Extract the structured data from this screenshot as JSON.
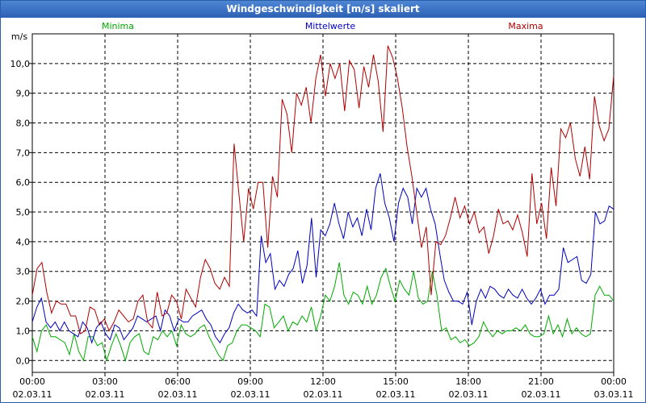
{
  "window": {
    "title": "Windgeschwindigkeit [m/s] skaliert"
  },
  "chart_data": {
    "type": "line",
    "title": "Windgeschwindigkeit [m/s] skaliert",
    "ylabel": "m/s",
    "ylim": [
      -0.4,
      11.0
    ],
    "yticks": [
      "0,0",
      "1,0",
      "2,0",
      "3,0",
      "4,0",
      "5,0",
      "6,0",
      "7,0",
      "8,0",
      "9,0",
      "10,0"
    ],
    "ytick_values": [
      0,
      1,
      2,
      3,
      4,
      5,
      6,
      7,
      8,
      9,
      10
    ],
    "xlim_hours": [
      0,
      24
    ],
    "xticks": [
      {
        "time": "00:00",
        "date": "02.03.11"
      },
      {
        "time": "03:00",
        "date": "02.03.11"
      },
      {
        "time": "06:00",
        "date": "02.03.11"
      },
      {
        "time": "09:00",
        "date": "02.03.11"
      },
      {
        "time": "12:00",
        "date": "02.03.11"
      },
      {
        "time": "15:00",
        "date": "02.03.11"
      },
      {
        "time": "18:00",
        "date": "02.03.11"
      },
      {
        "time": "21:00",
        "date": "02.03.11"
      },
      {
        "time": "00:00",
        "date": "03.03.11"
      }
    ],
    "grid": true,
    "legend_position": "top",
    "series": [
      {
        "name": "Minima",
        "color": "#00aa00",
        "values": [
          0.8,
          0.3,
          1.0,
          1.2,
          0.8,
          0.8,
          0.7,
          0.6,
          0.2,
          0.9,
          0.3,
          0.0,
          0.8,
          0.8,
          0.5,
          0.6,
          0.0,
          0.5,
          0.9,
          0.5,
          0.0,
          0.6,
          0.8,
          0.9,
          0.3,
          0.2,
          0.8,
          0.7,
          1.0,
          0.8,
          1.0,
          0.5,
          1.2,
          0.9,
          0.8,
          0.9,
          1.1,
          1.2,
          0.8,
          0.5,
          0.2,
          0.0,
          0.5,
          0.6,
          1.0,
          1.2,
          1.2,
          1.1,
          1.0,
          0.8,
          1.9,
          1.8,
          1.1,
          1.3,
          1.5,
          1.0,
          1.3,
          1.2,
          1.5,
          1.3,
          1.8,
          1.0,
          1.5,
          2.2,
          2.0,
          2.5,
          3.3,
          2.2,
          1.9,
          2.3,
          2.2,
          1.9,
          2.5,
          1.9,
          2.2,
          2.8,
          3.1,
          2.5,
          2.0,
          2.7,
          2.4,
          2.2,
          3.0,
          2.1,
          1.9,
          2.0,
          3.0,
          2.2,
          1.0,
          1.1,
          0.7,
          0.8,
          0.6,
          0.7,
          0.5,
          0.6,
          0.8,
          1.3,
          1.0,
          0.8,
          1.0,
          0.9,
          1.0,
          1.0,
          1.1,
          1.0,
          1.2,
          0.9,
          0.8,
          0.8,
          0.9,
          1.5,
          0.9,
          1.2,
          0.8,
          1.4,
          0.9,
          1.1,
          0.9,
          0.8,
          0.9,
          2.2,
          2.5,
          2.2,
          2.2,
          2.0
        ]
      },
      {
        "name": "Mittelwerte",
        "color": "#0000c0",
        "values": [
          1.3,
          1.8,
          2.1,
          1.3,
          1.1,
          1.3,
          1.0,
          1.3,
          1.0,
          0.9,
          0.8,
          1.3,
          1.1,
          0.6,
          1.1,
          1.3,
          0.9,
          0.7,
          1.2,
          1.1,
          0.7,
          0.9,
          1.1,
          1.5,
          1.4,
          1.3,
          1.4,
          1.5,
          1.0,
          1.7,
          1.5,
          1.0,
          1.4,
          1.3,
          1.3,
          1.5,
          1.6,
          1.7,
          1.4,
          1.2,
          0.8,
          0.6,
          0.9,
          1.1,
          1.6,
          1.9,
          1.7,
          1.6,
          1.7,
          1.5,
          4.2,
          3.3,
          3.6,
          2.4,
          2.7,
          2.5,
          2.9,
          3.1,
          3.7,
          2.6,
          3.2,
          4.8,
          2.8,
          4.4,
          4.2,
          4.6,
          5.3,
          4.6,
          4.1,
          5.0,
          4.5,
          4.8,
          4.2,
          5.1,
          4.4,
          5.8,
          6.3,
          5.3,
          4.8,
          4.0,
          5.3,
          5.8,
          5.5,
          4.6,
          5.8,
          5.5,
          5.8,
          5.1,
          4.6,
          3.6,
          2.7,
          2.3,
          2.0,
          2.0,
          1.9,
          2.3,
          1.2,
          2.0,
          2.4,
          2.1,
          2.5,
          2.4,
          2.2,
          2.1,
          2.4,
          2.2,
          2.1,
          2.4,
          2.1,
          1.9,
          2.1,
          2.4,
          1.9,
          2.2,
          2.2,
          2.4,
          3.8,
          3.3,
          3.4,
          3.5,
          2.7,
          2.6,
          2.9,
          5.0,
          4.6,
          4.7,
          5.2,
          5.1
        ]
      },
      {
        "name": "Maxima",
        "color": "#b00000",
        "values": [
          2.2,
          3.1,
          3.3,
          2.3,
          1.6,
          2.0,
          1.9,
          1.9,
          1.5,
          1.5,
          0.9,
          1.0,
          1.8,
          1.7,
          1.2,
          1.4,
          1.0,
          1.3,
          1.7,
          1.5,
          1.3,
          1.4,
          2.0,
          2.2,
          1.3,
          1.1,
          2.3,
          1.5,
          1.6,
          2.2,
          2.0,
          1.4,
          2.4,
          2.1,
          1.8,
          2.8,
          3.4,
          3.1,
          2.6,
          2.4,
          2.8,
          2.5,
          7.3,
          5.6,
          4.0,
          5.8,
          5.1,
          6.0,
          6.0,
          3.8,
          6.2,
          5.5,
          8.8,
          8.3,
          7.0,
          9.0,
          8.6,
          9.2,
          8.0,
          9.5,
          10.3,
          8.9,
          10.0,
          9.5,
          10.0,
          8.4,
          10.1,
          9.8,
          8.5,
          9.9,
          9.2,
          10.3,
          9.4,
          7.7,
          10.6,
          10.2,
          9.5,
          8.5,
          7.2,
          6.2,
          5.0,
          3.8,
          4.5,
          2.2,
          4.0,
          3.9,
          4.2,
          4.8,
          5.5,
          4.8,
          5.2,
          4.6,
          5.0,
          4.3,
          4.5,
          3.6,
          4.2,
          5.1,
          4.6,
          4.7,
          4.4,
          4.9,
          4.3,
          3.5,
          6.3,
          4.6,
          5.3,
          4.1,
          6.5,
          5.2,
          7.8,
          7.5,
          8.0,
          6.8,
          6.2,
          7.2,
          6.1,
          8.9,
          7.9,
          7.4,
          7.8,
          9.6
        ]
      }
    ]
  }
}
